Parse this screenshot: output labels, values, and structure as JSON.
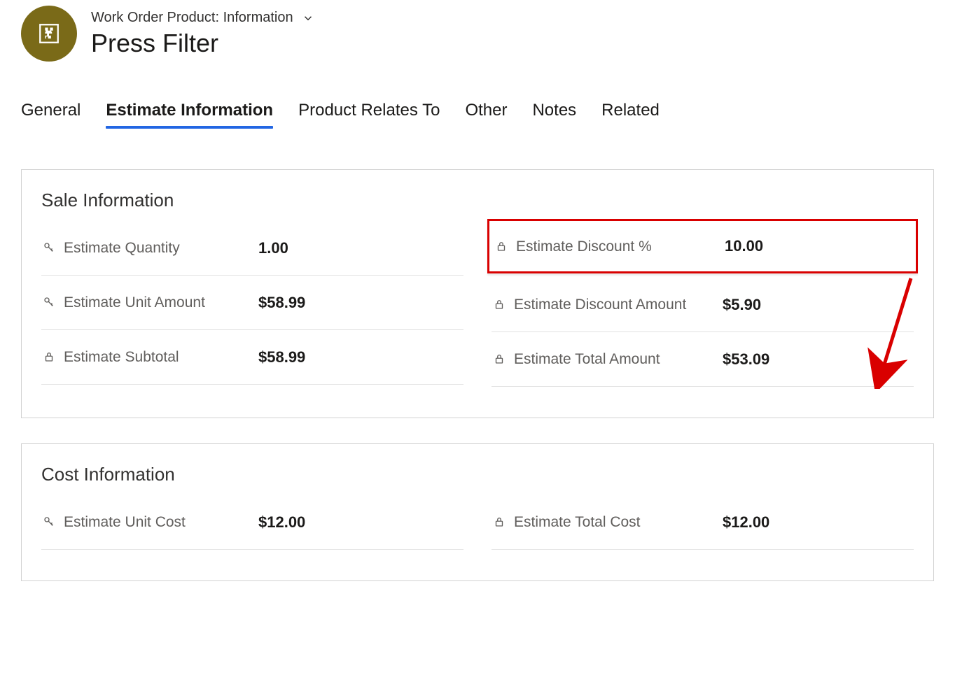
{
  "header": {
    "breadcrumb": "Work Order Product: Information",
    "title": "Press Filter"
  },
  "tabs": [
    {
      "label": "General",
      "active": false
    },
    {
      "label": "Estimate Information",
      "active": true
    },
    {
      "label": "Product Relates To",
      "active": false
    },
    {
      "label": "Other",
      "active": false
    },
    {
      "label": "Notes",
      "active": false
    },
    {
      "label": "Related",
      "active": false
    }
  ],
  "sections": {
    "sale": {
      "title": "Sale Information",
      "left": [
        {
          "icon": "key",
          "label": "Estimate Quantity",
          "value": "1.00"
        },
        {
          "icon": "key",
          "label": "Estimate Unit Amount",
          "value": "$58.99"
        },
        {
          "icon": "lock",
          "label": "Estimate Subtotal",
          "value": "$58.99"
        }
      ],
      "right": [
        {
          "icon": "lock",
          "label": "Estimate Discount %",
          "value": "10.00",
          "highlight": true
        },
        {
          "icon": "lock",
          "label": "Estimate Discount Amount",
          "value": "$5.90"
        },
        {
          "icon": "lock",
          "label": "Estimate Total Amount",
          "value": "$53.09"
        }
      ]
    },
    "cost": {
      "title": "Cost Information",
      "left": [
        {
          "icon": "key",
          "label": "Estimate Unit Cost",
          "value": "$12.00"
        }
      ],
      "right": [
        {
          "icon": "lock",
          "label": "Estimate Total Cost",
          "value": "$12.00"
        }
      ]
    }
  },
  "colors": {
    "accent": "#2266e3",
    "highlight": "#d90000",
    "entity_bg": "#7a6a18"
  }
}
